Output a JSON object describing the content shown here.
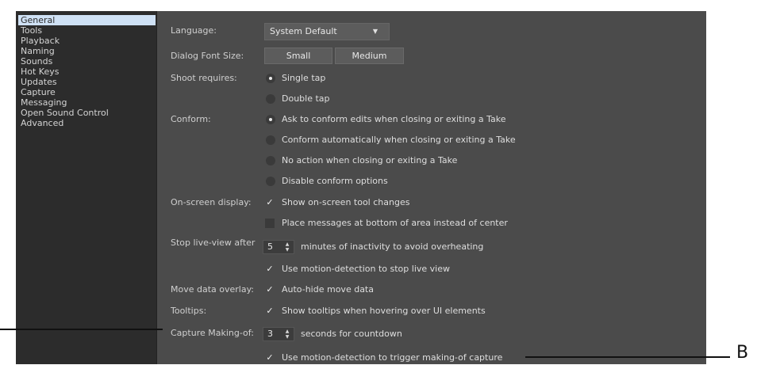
{
  "sidebar": {
    "items": [
      {
        "label": "General",
        "selected": true
      },
      {
        "label": "Tools"
      },
      {
        "label": "Playback"
      },
      {
        "label": "Naming"
      },
      {
        "label": "Sounds"
      },
      {
        "label": "Hot Keys"
      },
      {
        "label": "Updates"
      },
      {
        "label": "Capture"
      },
      {
        "label": "Messaging"
      },
      {
        "label": "Open Sound Control"
      },
      {
        "label": "Advanced"
      }
    ]
  },
  "language": {
    "label": "Language:",
    "value": "System Default"
  },
  "font_size": {
    "label": "Dialog Font Size:",
    "options": [
      "Small",
      "Medium"
    ]
  },
  "shoot": {
    "label": "Shoot requires:",
    "options": [
      "Single tap",
      "Double tap"
    ],
    "selected": 0
  },
  "conform": {
    "label": "Conform:",
    "options": [
      "Ask to conform edits when closing or exiting a Take",
      "Conform automatically when closing or exiting a Take",
      "No action when closing or exiting a Take",
      "Disable conform options"
    ],
    "selected": 0
  },
  "onscreen": {
    "label": "On-screen display:",
    "show_changes": {
      "text": "Show on-screen tool changes",
      "checked": true
    },
    "place_bottom": {
      "text": "Place messages at bottom of area instead of center",
      "checked": false
    }
  },
  "live_view": {
    "label": "Stop live-view after",
    "minutes": "5",
    "suffix": "minutes of inactivity to avoid overheating",
    "motion": {
      "text": "Use motion-detection to stop live view",
      "checked": true
    }
  },
  "move_overlay": {
    "label": "Move data overlay:",
    "text": "Auto-hide move data",
    "checked": true
  },
  "tooltips": {
    "label": "Tooltips:",
    "text": "Show tooltips when hovering over UI elements",
    "checked": true
  },
  "making_of": {
    "label": "Capture Making-of:",
    "seconds": "3",
    "suffix": "seconds for countdown",
    "motion": {
      "text": "Use motion-detection to trigger making-of capture",
      "checked": true
    }
  },
  "callouts": {
    "b": "B"
  },
  "glyphs": {
    "check": "✓",
    "caret": "▼",
    "up": "▲",
    "down": "▼"
  }
}
